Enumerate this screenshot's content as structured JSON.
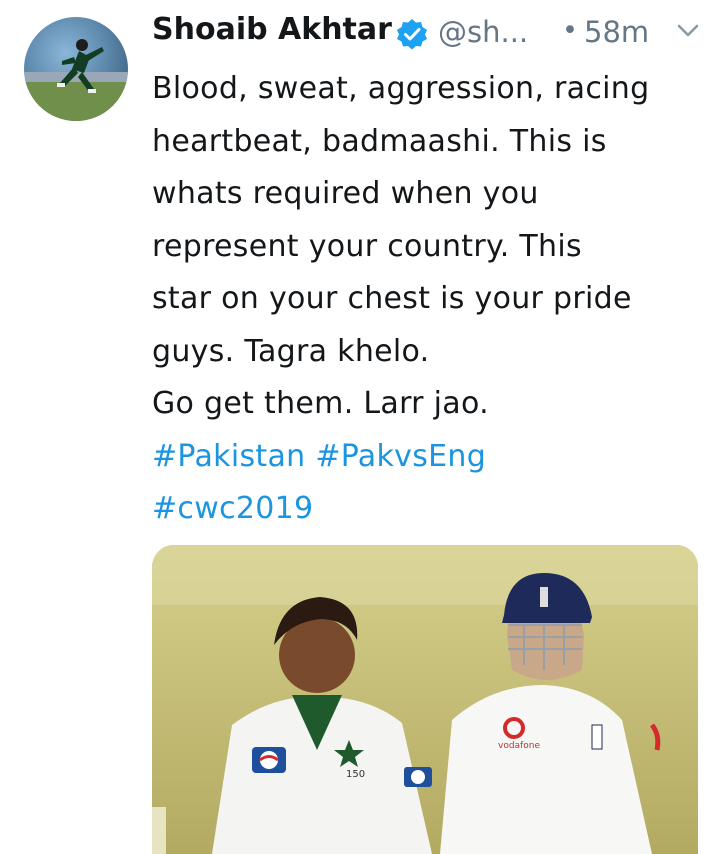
{
  "tweet": {
    "author": {
      "display_name": "Shoaib Akhtar",
      "handle": "@sh...",
      "verified": true,
      "verified_icon": "verified-badge-icon",
      "avatar": "avatar"
    },
    "separator": "•",
    "timestamp": "58m",
    "menu_icon": "chevron-down-icon",
    "text_lines": [
      "Blood, sweat, aggression, racing",
      "heartbeat,  badmaashi. This is",
      "whats required when you",
      "represent your country. This",
      "star on your chest is your pride",
      "guys. Tagra khelo.",
      "Go get them. Larr jao."
    ],
    "hashtags_line1": [
      "#Pakistan",
      "#PakvsEng"
    ],
    "hashtags_line2": [
      "#cwc2019"
    ],
    "media": {
      "shirt_number": "150",
      "sponsor_text": "vodafone"
    }
  },
  "colors": {
    "text": "#14171a",
    "secondary": "#657786",
    "link": "#1b95e0",
    "verified": "#1da1f2",
    "background": "#ffffff"
  }
}
